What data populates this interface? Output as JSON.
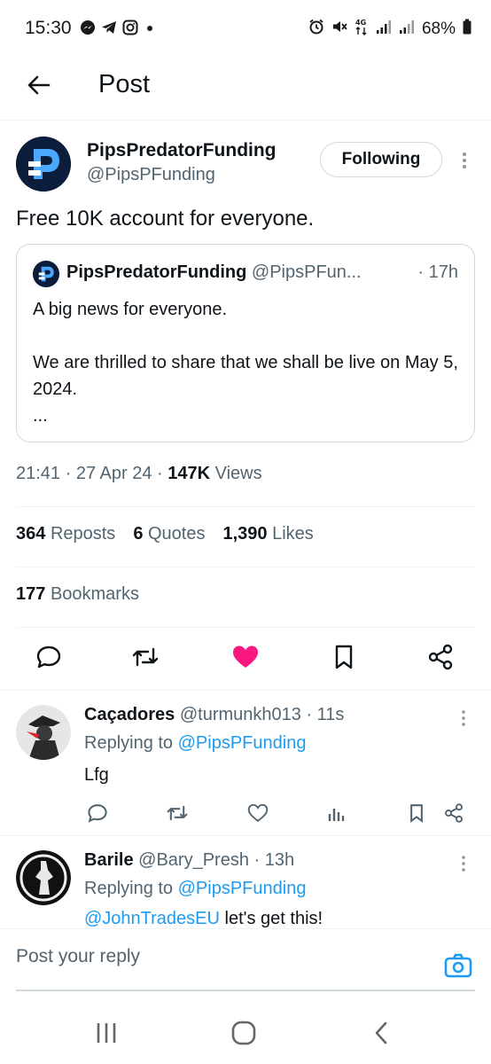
{
  "status": {
    "time": "15:30",
    "battery": "68%",
    "left_icons": [
      "messenger-icon",
      "telegram-icon",
      "instagram-icon",
      "dot-icon"
    ],
    "right_icons": [
      "alarm-icon",
      "mute-icon",
      "4g-icon",
      "signal-icon",
      "signal-icon",
      "battery-icon"
    ]
  },
  "header": {
    "title": "Post"
  },
  "post": {
    "author_name": "PipsPredatorFunding",
    "author_handle": "@PipsPFunding",
    "follow_label": "Following",
    "text": "Free 10K account for everyone.",
    "quote": {
      "name": "PipsPredatorFunding",
      "handle": "@PipsPFun...",
      "time": "· 17h",
      "line1": "A big news for everyone.",
      "line2": "We are thrilled to share that we shall be live on May 5, 2024.",
      "ellipsis": "..."
    },
    "meta": {
      "time": "21:41",
      "date": "27 Apr 24",
      "views_count": "147K",
      "views_label": "Views",
      "sep": " · "
    },
    "stats": {
      "reposts_count": "364",
      "reposts_label": "Reposts",
      "quotes_count": "6",
      "quotes_label": "Quotes",
      "likes_count": "1,390",
      "likes_label": "Likes",
      "bookmarks_count": "177",
      "bookmarks_label": "Bookmarks"
    },
    "liked": true,
    "like_color": "#f91880"
  },
  "replies": [
    {
      "name": "Caçadores",
      "handle": "@turmunkh013",
      "time": " · 11s",
      "replying_label": "Replying to ",
      "replying_handle": "@PipsPFunding",
      "text": "Lfg"
    },
    {
      "name": "Barile",
      "handle": "@Bary_Presh",
      "time": " · 13h",
      "replying_label": "Replying to ",
      "replying_handle": "@PipsPFunding",
      "mention": "@JohnTradesEU",
      "text": " let's get this!"
    }
  ],
  "reply_box": {
    "placeholder": "Post your reply"
  },
  "colors": {
    "accent": "#1d9bf0",
    "text": "#0f1419",
    "muted": "#536471"
  }
}
